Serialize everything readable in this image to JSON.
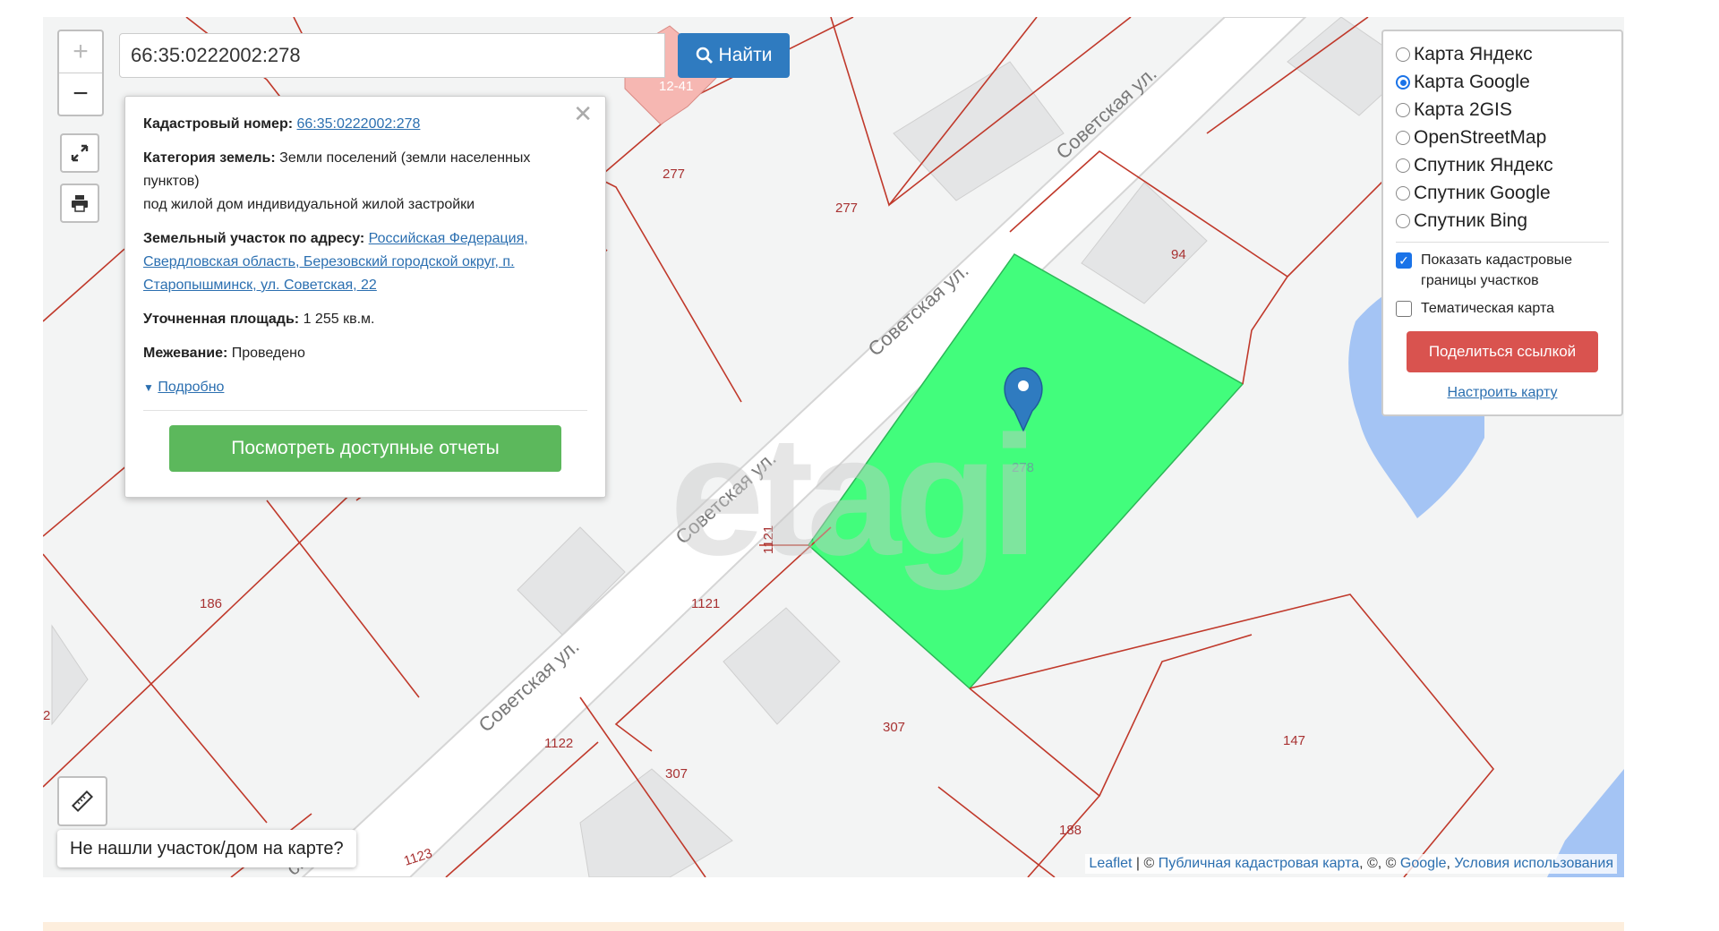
{
  "search": {
    "value": "66:35:0222002:278",
    "button_label": "Найти"
  },
  "zoom": {
    "plus": "+",
    "minus": "−"
  },
  "popup": {
    "cadastral_label": "Кадастровый номер:",
    "cadastral_value": "66:35:0222002:278",
    "category_label": "Категория земель:",
    "category_value": "Земли поселений (земли населенных пунктов)",
    "usage": "под жилой дом индивидуальной жилой застройки",
    "address_label": "Земельный участок по адресу:",
    "address_value": "Российская Федерация, Свердловская область, Березовский городской округ, п. Старопышминск, ул. Советская, 22",
    "area_label": "Уточненная площадь:",
    "area_value": "1 255 кв.м.",
    "survey_label": "Межевание:",
    "survey_value": "Проведено",
    "details_link": "Подробно",
    "reports_button": "Посмотреть доступные отчеты"
  },
  "layers": {
    "options": [
      {
        "label": "Карта Яндекс",
        "selected": false
      },
      {
        "label": "Карта Google",
        "selected": true
      },
      {
        "label": "Карта 2GIS",
        "selected": false
      },
      {
        "label": "OpenStreetMap",
        "selected": false
      },
      {
        "label": "Спутник Яндекс",
        "selected": false
      },
      {
        "label": "Спутник Google",
        "selected": false
      },
      {
        "label": "Спутник Bing",
        "selected": false
      }
    ],
    "show_boundaries": {
      "label": "Показать кадастровые границы участков",
      "checked": true
    },
    "thematic": {
      "label": "Тематическая карта",
      "checked": false
    },
    "share_button": "Поделиться ссылкой",
    "setup_link": "Настроить карту"
  },
  "not_found": "Не нашли участок/дом на карте?",
  "attribution": {
    "leaflet": "Leaflet",
    "public_map": "Публичная кадастровая карта",
    "google": "Google",
    "terms": "Условия использования",
    "sep1": " | © ",
    "sep2": ", ©, © ",
    "sep3": ", "
  },
  "map_labels": {
    "street": "Советская ул.",
    "street_partial": "ск",
    "plots": [
      "277",
      "277",
      "94",
      "186",
      "1121",
      "1121",
      "278",
      "1122",
      "307",
      "307",
      "147",
      "188",
      "1123",
      "12-41",
      "2"
    ]
  },
  "watermark": "etagi",
  "colors": {
    "plot_fill": "#42fd7c",
    "boundary": "#c0392b",
    "water": "#a4c4f4",
    "accent": "#2f7bc0"
  }
}
